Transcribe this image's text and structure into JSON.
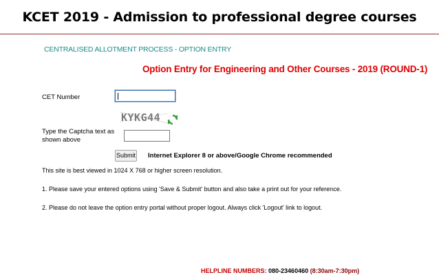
{
  "header": {
    "title": "KCET 2019 - Admission to professional degree courses"
  },
  "process": {
    "heading": "CENTRALISED ALLOTMENT PROCESS - OPTION ENTRY"
  },
  "form": {
    "heading": "Option Entry for Engineering and Other Courses - 2019 (ROUND-1)",
    "cet_label": "CET Number",
    "cet_value": "",
    "captcha_text": "KYKG44",
    "captcha_label": "Type the Captcha text as shown above",
    "captcha_value": "",
    "submit_label": "Submit",
    "browser_note": "Internet Explorer 8 or above/Google Chrome recommended",
    "refresh_icon": "refresh-icon"
  },
  "notes": {
    "resolution": "This site is best viewed in 1024 X 768 or higher screen resolution.",
    "note1": "1. Please save your entered options using 'Save & Submit' button and also take a print out for your reference.",
    "note2": "2. Please do not leave the option entry portal without proper logout. Always click 'Logout' link to logout."
  },
  "helpline": {
    "label": "HELPLINE NUMBERS:",
    "number": "080-23460460",
    "hours": "(8:30am-7:30pm)"
  },
  "colors": {
    "process_heading": "#1a8a8a",
    "form_heading": "#e00000",
    "rule": "#8b2a2a"
  }
}
